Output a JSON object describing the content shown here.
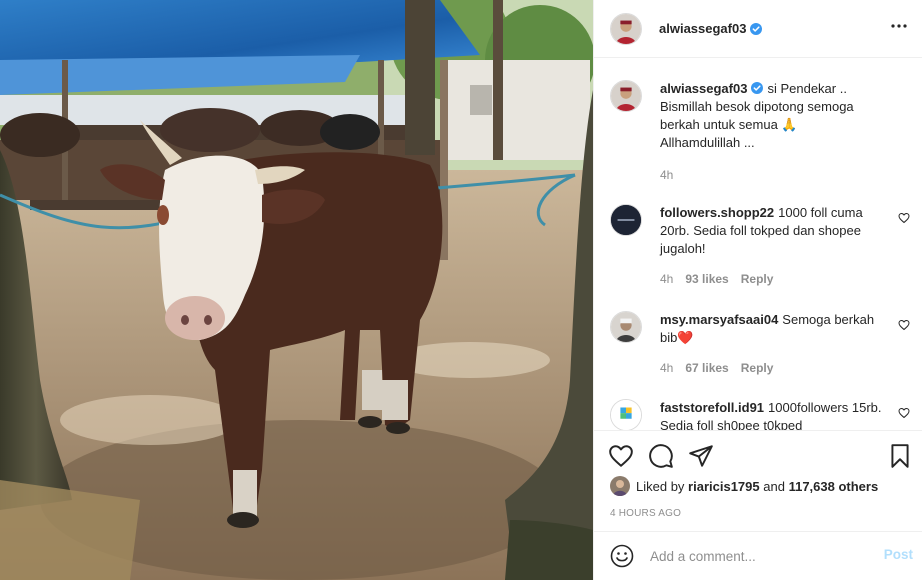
{
  "post": {
    "author": "alwiassegaf03",
    "caption_lines": [
      "si Pendekar ..",
      "Bismillah besok dipotong semoga",
      "berkah untuk semua 🙏",
      "Allhamdulillah ..."
    ],
    "caption_time": "4h"
  },
  "comments": [
    {
      "username": "followers.shopp22",
      "text": "1000 foll cuma 20rb. Sedia foll tokped dan shopee jugaloh!",
      "time": "4h",
      "likes": "93 likes",
      "reply": "Reply"
    },
    {
      "username": "msy.marsyafsaai04",
      "text": "Semoga berkah bib",
      "emoji": "❤️",
      "time": "4h",
      "likes": "67 likes",
      "reply": "Reply"
    },
    {
      "username": "faststorefoll.id91",
      "text": "1000followers 15rb. Sedia foll sh0pee t0kped"
    }
  ],
  "likes": {
    "prefix": "Liked by",
    "user": "riaricis1795",
    "connector": "and",
    "others": "117,638 others"
  },
  "timestamp": "4 HOURS AGO",
  "add_comment": {
    "placeholder": "Add a comment...",
    "post_label": "Post"
  },
  "colors": {
    "verified": "#3897f0",
    "post_disabled": "#b2dffc",
    "secondary_text": "#8e8e8e",
    "heart_red": "#ed4956"
  },
  "icons": [
    "more-options-icon",
    "verified-badge-icon",
    "heart-icon",
    "comment-icon",
    "share-icon",
    "bookmark-icon",
    "emoji-icon",
    "small-heart-icon"
  ]
}
